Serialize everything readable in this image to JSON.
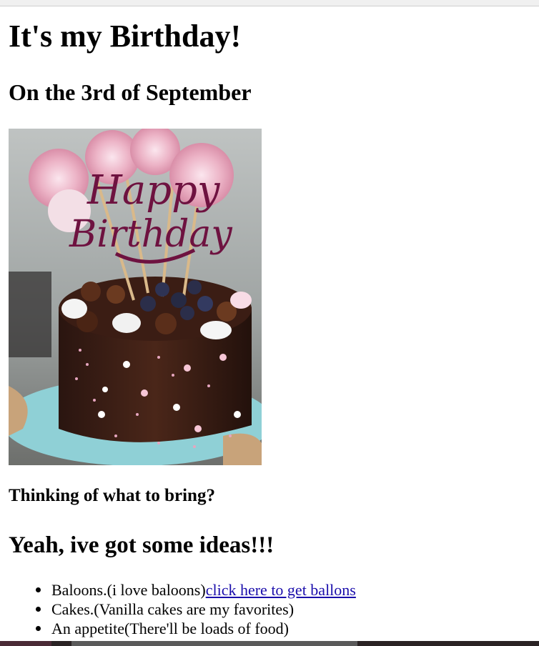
{
  "page": {
    "heading": "It's my Birthday!",
    "subheading": "On the 3rd of September",
    "image_alt": "Chocolate birthday cake with Happy Birthday topper",
    "topper_text_line1": "Happy",
    "topper_text_line2": "Birthday",
    "question": "Thinking of what to bring?",
    "ideas_heading": "Yeah, ive got some ideas!!!",
    "list": [
      {
        "text": "Baloons.(i love baloons)",
        "link": "click here to get ballons"
      },
      {
        "text": "Cakes.(Vanilla cakes are my favorites)"
      },
      {
        "text": "An appetite(There'll be loads of food)"
      }
    ]
  },
  "colors": {
    "link": "#1a0dab",
    "background": "#ffffff",
    "text": "#000000"
  }
}
